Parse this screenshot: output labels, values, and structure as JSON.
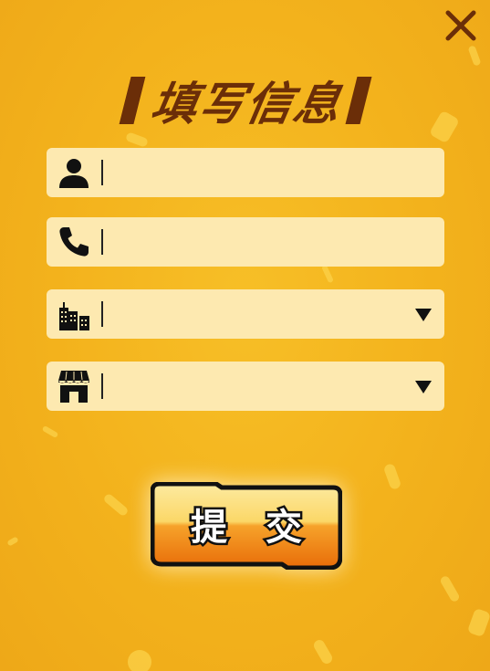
{
  "dialog": {
    "title": "填写信息",
    "close_icon": "close-icon"
  },
  "form": {
    "fields": [
      {
        "name": "name",
        "icon": "person-icon",
        "value": "",
        "type": "text"
      },
      {
        "name": "phone",
        "icon": "phone-icon",
        "value": "",
        "type": "text"
      },
      {
        "name": "city",
        "icon": "buildings-icon",
        "value": "",
        "type": "select"
      },
      {
        "name": "store",
        "icon": "storefront-icon",
        "value": "",
        "type": "select"
      }
    ],
    "submit_label": "提 交"
  },
  "colors": {
    "background": "#f3b21c",
    "field_bg": "#fde9b0",
    "title": "#6b2e08",
    "button_top": "#fde08a",
    "button_bottom": "#f07f10"
  }
}
